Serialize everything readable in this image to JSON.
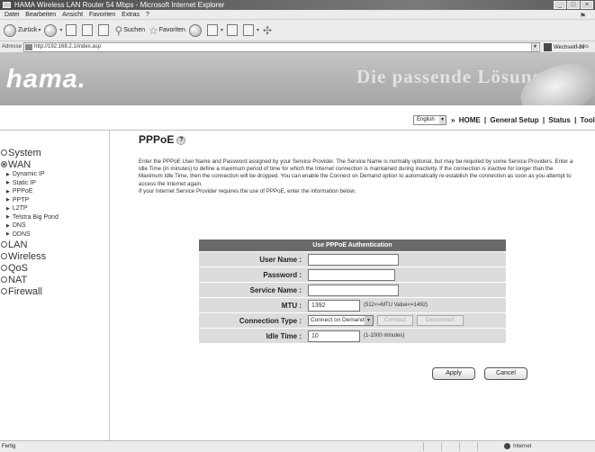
{
  "window": {
    "title": "HAMA Wireless LAN Router 54 Mbps - Microsoft Internet Explorer",
    "controls": {
      "minimize": "_",
      "maximize": "□",
      "close": "×"
    }
  },
  "menubar": {
    "items": [
      "Datei",
      "Bearbeiten",
      "Ansicht",
      "Favoriten",
      "Extras",
      "?"
    ]
  },
  "toolbar": {
    "back": "Zurück",
    "search": "Suchen",
    "favorites": "Favoriten"
  },
  "addressbar": {
    "label": "Adresse",
    "url": "http://192.168.2.1/index.asp",
    "go": "Wechseln zu",
    "links": "Links"
  },
  "banner": {
    "logo": "hama.",
    "slogan": "Die passende Lösung"
  },
  "topbar": {
    "language": "English",
    "nav": [
      "HOME",
      "General Setup",
      "Status",
      "Tools"
    ],
    "separator": "|",
    "bullet": "»"
  },
  "sidebar": {
    "items": [
      {
        "label": "System"
      },
      {
        "label": "WAN",
        "open": true,
        "sub": [
          "Dynamic IP",
          "Static IP",
          "PPPoE",
          "PPTP",
          "L2TP",
          "Telstra Big Pond",
          "DNS",
          "DDNS"
        ]
      },
      {
        "label": "LAN"
      },
      {
        "label": "Wireless"
      },
      {
        "label": "QoS"
      },
      {
        "label": "NAT"
      },
      {
        "label": "Firewall"
      }
    ]
  },
  "page": {
    "title": "PPPoE",
    "description_1": "Enter the PPPoE User Name and Password assigned by your Service Provider. The Service Name is normally optional, but may be required by some Service Providers. Enter a Idle Time (in minutes) to define a maximum period of time for which the Internet connection is maintained during inactivity. If the connection is inactive for longer than the Maximum Idle Time, then the connection will be dropped. You can enable the Connect on Demand option to automatically re-establish the connection as soon as you attempt to access the Internet again.",
    "description_2": "If your Internet Service Provider requires the use of PPPoE, enter the information below."
  },
  "form": {
    "header": "Use PPPoE Authentication",
    "user_name_label": "User Name :",
    "user_name_value": "",
    "password_label": "Password :",
    "password_value": "",
    "service_name_label": "Service Name :",
    "service_name_value": "",
    "mtu_label": "MTU :",
    "mtu_value": "1392",
    "mtu_hint": "(512<=MTU Value<=1492)",
    "connection_type_label": "Connection Type :",
    "connection_type_value": "Connect on Demand",
    "connect_label": "Connect",
    "disconnect_label": "Disconnect",
    "idle_time_label": "Idle Time :",
    "idle_time_value": "10",
    "idle_time_hint": "(1-1000 minutes)"
  },
  "actions": {
    "apply": "Apply",
    "cancel": "Cancel"
  },
  "statusbar": {
    "status": "Fertig",
    "zone": "Internet"
  }
}
